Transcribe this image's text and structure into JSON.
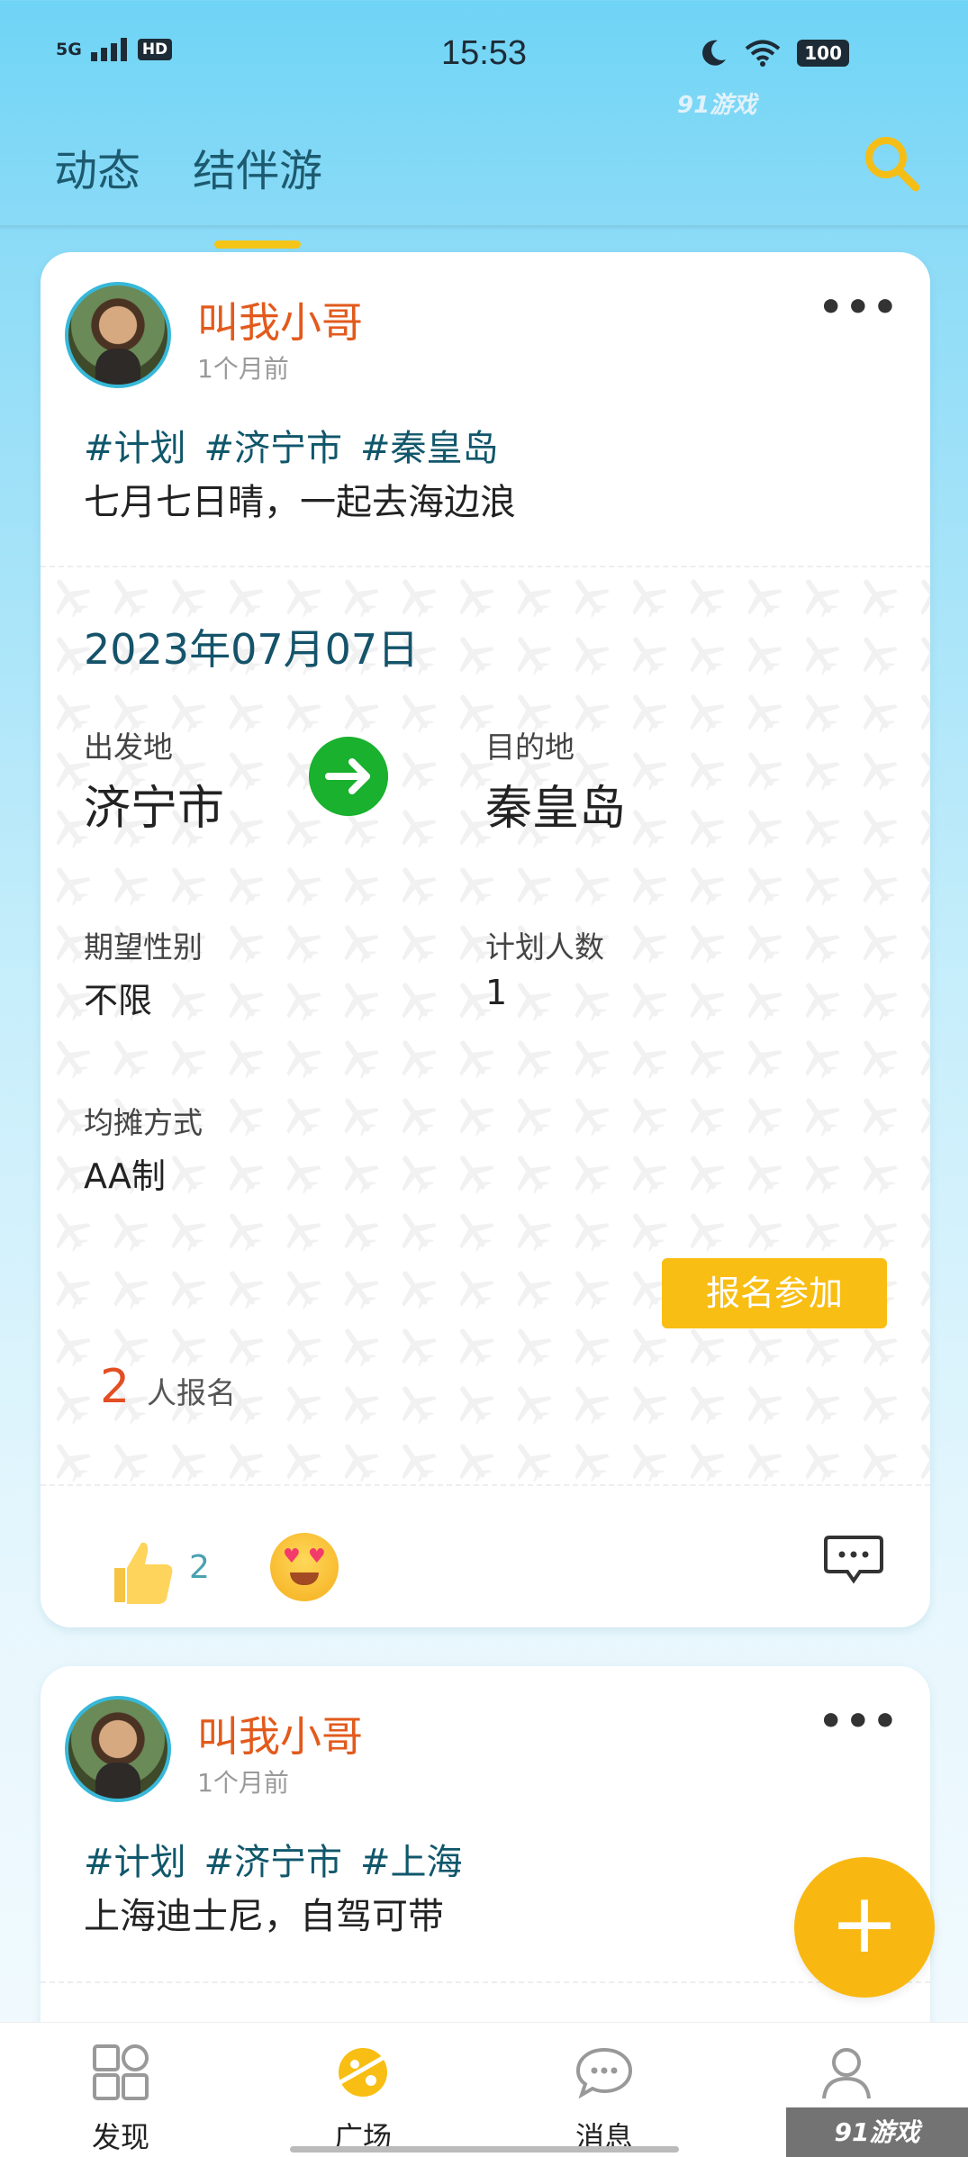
{
  "status_bar": {
    "signal": "5G",
    "hd": "HD",
    "time": "15:53",
    "battery": "100"
  },
  "watermark_top": "91游戏",
  "header": {
    "tabs": [
      {
        "label": "动态"
      },
      {
        "label": "结伴游"
      }
    ],
    "active_tab": "结伴游"
  },
  "posts": [
    {
      "username": "叫我小哥",
      "time": "1个月前",
      "tags": [
        "#计划",
        "#济宁市",
        "#秦皇岛"
      ],
      "text": "七月七日晴，一起去海边浪",
      "date": "2023年07月07日",
      "origin_label": "出发地",
      "origin": "济宁市",
      "destination_label": "目的地",
      "destination": "秦皇岛",
      "gender_label": "期望性别",
      "gender": "不限",
      "people_label": "计划人数",
      "people": "1",
      "split_label": "均摊方式",
      "split": "AA制",
      "join_label": "报名参加",
      "signup_count": "2",
      "signup_label": "人报名",
      "likes": "2"
    },
    {
      "username": "叫我小哥",
      "time": "1个月前",
      "tags": [
        "#计划",
        "#济宁市",
        "#上海"
      ],
      "text": "上海迪士尼，自驾可带"
    }
  ],
  "fab": "+",
  "tabbar": [
    {
      "label": "发现",
      "icon": "discover-icon"
    },
    {
      "label": "广场",
      "icon": "plaza-icon"
    },
    {
      "label": "消息",
      "icon": "message-icon"
    },
    {
      "label": "",
      "icon": "profile-icon"
    }
  ],
  "watermark_bottom": "91游戏",
  "colors": {
    "accent": "#f9be13",
    "username": "#e25a1c",
    "tag": "#10576b",
    "arrow": "#19b12e"
  }
}
